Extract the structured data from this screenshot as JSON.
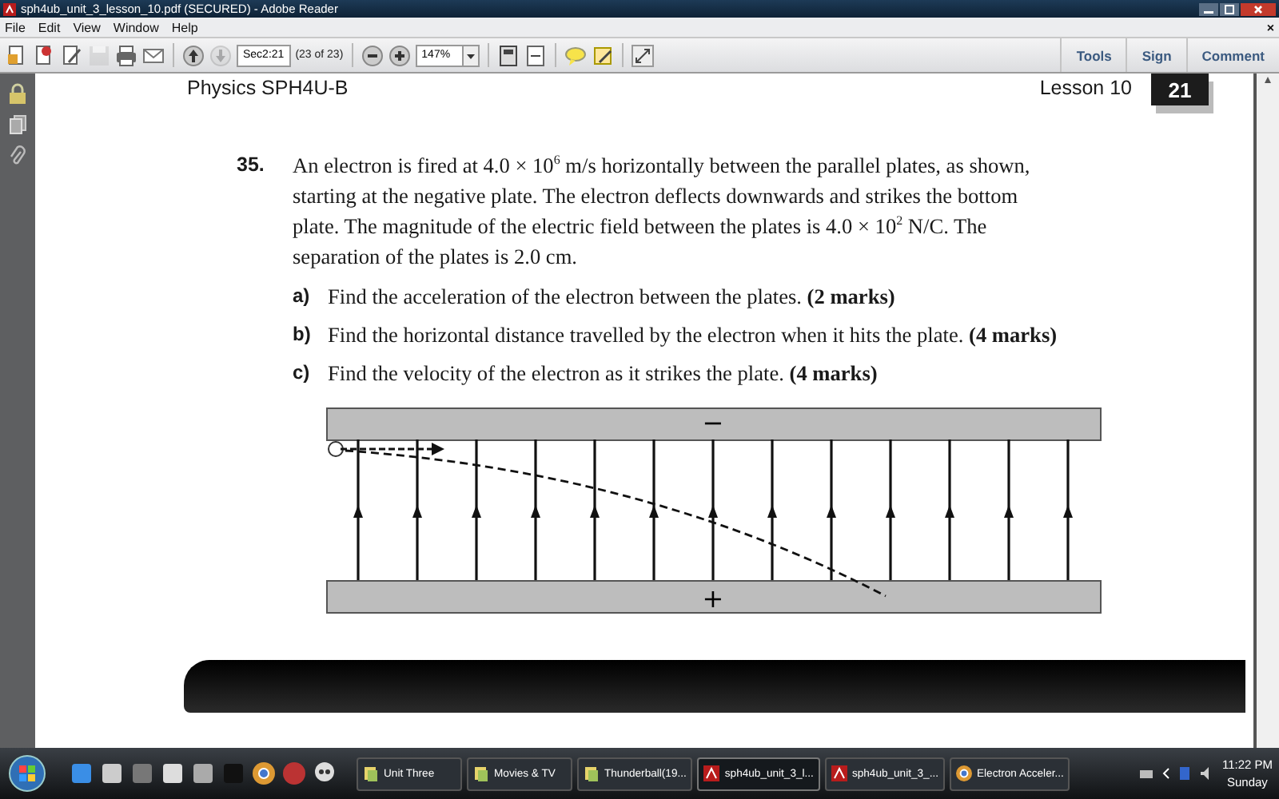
{
  "window": {
    "title": "sph4ub_unit_3_lesson_10.pdf (SECURED) - Adobe Reader"
  },
  "menu": {
    "items": [
      "File",
      "Edit",
      "View",
      "Window",
      "Help"
    ],
    "close": "×"
  },
  "toolbar": {
    "page_field": "Sec2:21",
    "page_count": "(23 of 23)",
    "zoom": "147%",
    "panels": [
      "Tools",
      "Sign",
      "Comment"
    ]
  },
  "page": {
    "course": "Physics SPH4U-B",
    "lesson": "Lesson 10",
    "page_number": "21",
    "question": {
      "number": "35.",
      "text": "An electron is fired at 4.0 × 10$^{6}$ m/s horizontally between the parallel plates, as shown, starting at the negative plate. The electron deflects downwards and strikes the bottom plate. The magnitude of the electric field between the plates is 4.0 × 10$^{2}$ N/C. The separation of the plates is 2.0 cm.",
      "parts": [
        {
          "label": "a)",
          "text": "Find the acceleration of the electron between the plates. **(2 marks)**"
        },
        {
          "label": "b)",
          "text": "Find the horizontal distance travelled by the electron when it hits the plate. **(4 marks)**"
        },
        {
          "label": "c)",
          "text": "Find the velocity of the electron as it strikes the plate. **(4 marks)**"
        }
      ]
    },
    "diagram": {
      "top_plate_sign": "−",
      "bottom_plate_sign": "+"
    }
  },
  "taskbar": {
    "buttons": [
      {
        "label": "Unit Three",
        "kind": "folder",
        "selected": false
      },
      {
        "label": "Movies & TV",
        "kind": "folder",
        "selected": false
      },
      {
        "label": "Thunderball(19...",
        "kind": "folder",
        "selected": false
      },
      {
        "label": "sph4ub_unit_3_l...",
        "kind": "pdf",
        "selected": true
      },
      {
        "label": "sph4ub_unit_3_...",
        "kind": "pdf",
        "selected": false
      },
      {
        "label": "Electron Acceler...",
        "kind": "browser",
        "selected": false
      }
    ],
    "clock": {
      "time": "11:22 PM",
      "day": "Sunday"
    }
  }
}
